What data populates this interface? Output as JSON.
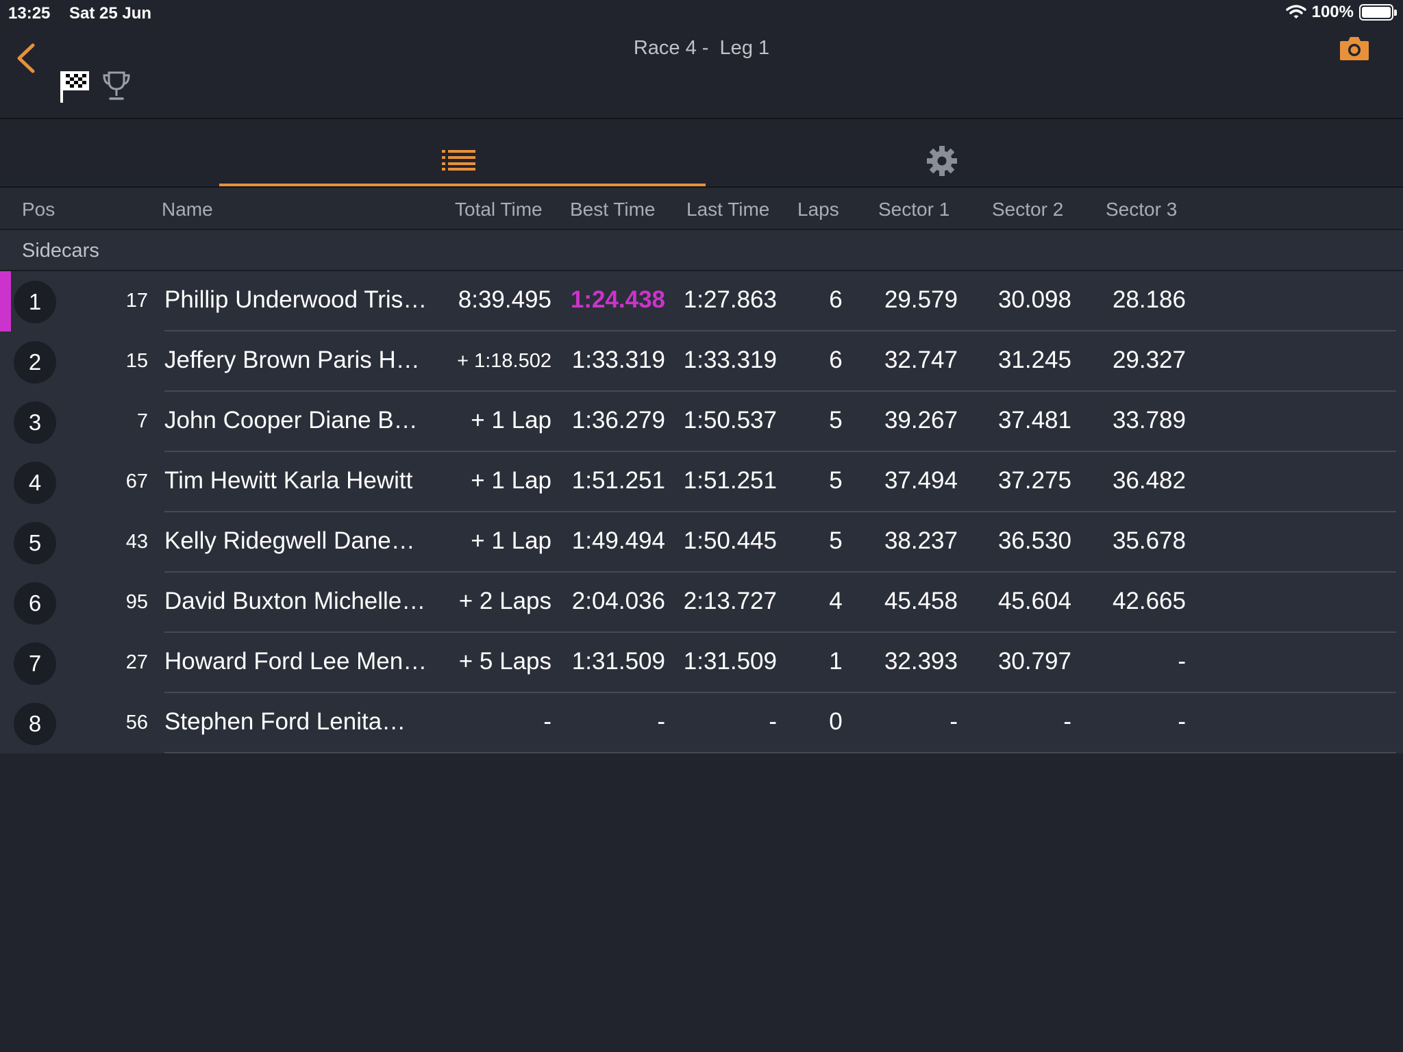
{
  "status": {
    "time": "13:25",
    "date": "Sat 25 Jun",
    "battery": "100%"
  },
  "nav": {
    "title": "Race 4 -  Leg 1"
  },
  "colors": {
    "accent": "#e8913a",
    "fastest": "#cc33cc",
    "background": "#21242d"
  },
  "icons": [
    "chevron-left-icon",
    "checkered-flag-icon",
    "trophy-icon",
    "camera-icon",
    "list-icon",
    "gear-icon",
    "wifi-icon",
    "battery-icon"
  ],
  "columns": {
    "pos": "Pos",
    "name": "Name",
    "total": "Total Time",
    "best": "Best Time",
    "last": "Last Time",
    "laps": "Laps",
    "s1": "Sector 1",
    "s2": "Sector 2",
    "s3": "Sector 3"
  },
  "group": "Sidecars",
  "rows": [
    {
      "pos": "1",
      "num": "17",
      "name": "Phillip Underwood Tris…",
      "total": "8:39.495",
      "best": "1:24.438",
      "last": "1:27.863",
      "laps": "6",
      "s1": "29.579",
      "s2": "30.098",
      "s3": "28.186"
    },
    {
      "pos": "2",
      "num": "15",
      "name": "Jeffery Brown Paris H…",
      "total": "+ 1:18.502",
      "best": "1:33.319",
      "last": "1:33.319",
      "laps": "6",
      "s1": "32.747",
      "s2": "31.245",
      "s3": "29.327"
    },
    {
      "pos": "3",
      "num": "7",
      "name": "John Cooper Diane B…",
      "total": "+ 1 Lap",
      "best": "1:36.279",
      "last": "1:50.537",
      "laps": "5",
      "s1": "39.267",
      "s2": "37.481",
      "s3": "33.789"
    },
    {
      "pos": "4",
      "num": "67",
      "name": "Tim Hewitt Karla Hewitt",
      "total": "+ 1 Lap",
      "best": "1:51.251",
      "last": "1:51.251",
      "laps": "5",
      "s1": "37.494",
      "s2": "37.275",
      "s3": "36.482"
    },
    {
      "pos": "5",
      "num": "43",
      "name": "Kelly Ridegwell Dane…",
      "total": "+ 1 Lap",
      "best": "1:49.494",
      "last": "1:50.445",
      "laps": "5",
      "s1": "38.237",
      "s2": "36.530",
      "s3": "35.678"
    },
    {
      "pos": "6",
      "num": "95",
      "name": "David Buxton Michelle…",
      "total": "+ 2 Laps",
      "best": "2:04.036",
      "last": "2:13.727",
      "laps": "4",
      "s1": "45.458",
      "s2": "45.604",
      "s3": "42.665"
    },
    {
      "pos": "7",
      "num": "27",
      "name": "Howard Ford Lee Men…",
      "total": "+ 5 Laps",
      "best": "1:31.509",
      "last": "1:31.509",
      "laps": "1",
      "s1": "32.393",
      "s2": "30.797",
      "s3": "-"
    },
    {
      "pos": "8",
      "num": "56",
      "name": "Stephen Ford Lenita…",
      "total": "-",
      "best": "-",
      "last": "-",
      "laps": "0",
      "s1": "-",
      "s2": "-",
      "s3": "-"
    }
  ]
}
